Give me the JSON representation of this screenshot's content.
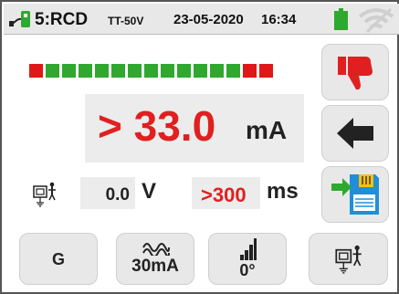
{
  "header": {
    "function": "5:RCD",
    "system": "TT-50V",
    "date": "23-05-2020",
    "time": "16:34",
    "battery_color": "#2fa82f",
    "icons": [
      "plug-icon",
      "battery-icon",
      "wifi-off-icon"
    ]
  },
  "progress": {
    "segments": [
      "#e01818",
      "#2fa82f",
      "#2fa82f",
      "#2fa82f",
      "#2fa82f",
      "#2fa82f",
      "#2fa82f",
      "#2fa82f",
      "#2fa82f",
      "#2fa82f",
      "#2fa82f",
      "#2fa82f",
      "#2fa82f",
      "#e01818",
      "#e01818"
    ]
  },
  "measurement": {
    "current_value": "> 33.0",
    "current_unit": "mA",
    "voltage_value": "0.0",
    "voltage_unit": "V",
    "trip_time_value": ">300",
    "trip_time_unit": "ms",
    "earth-icon": "earth-probe-icon"
  },
  "side_buttons": {
    "result_icon": "thumbs-down-icon",
    "back_icon": "back-arrow-icon",
    "save_icon": "save-icon"
  },
  "bottom_buttons": {
    "b1_label": "G",
    "b2_label": "30mA",
    "b2_icon": "waveform-icon",
    "b3_label": "0°",
    "b3_icon": "phase-steps-icon",
    "b4_icon": "earth-probe-icon"
  },
  "colors": {
    "red": "#e02020",
    "green": "#2fa82f"
  }
}
